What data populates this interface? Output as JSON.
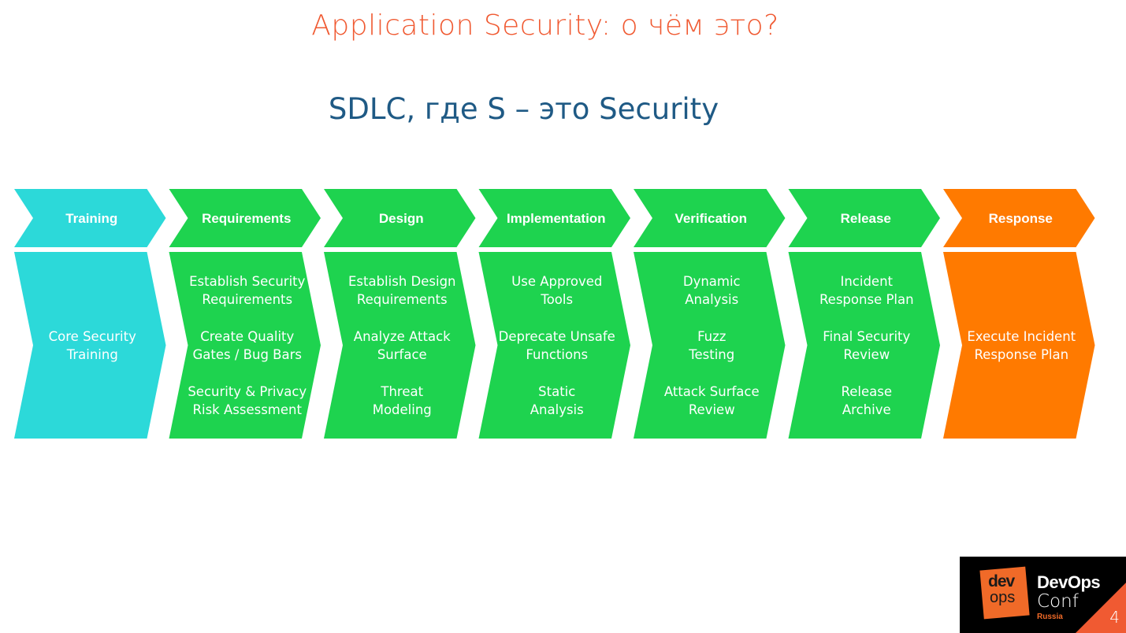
{
  "slide": {
    "title": "Application Security: о чём это?",
    "subtitle": "SDLC, где S – это Security",
    "page_number": "4"
  },
  "colors": {
    "title": "#f05a32",
    "subtitle": "#1f5a85",
    "training": "#2cd9d9",
    "phase": "#1ed34f",
    "response": "#ff7a00"
  },
  "phases": [
    {
      "name": "Training",
      "color_key": "training",
      "practices": [
        "Core Security\nTraining"
      ]
    },
    {
      "name": "Requirements",
      "color_key": "phase",
      "practices": [
        "Establish Security\nRequirements",
        "Create Quality\nGates / Bug Bars",
        "Security & Privacy\nRisk Assessment"
      ]
    },
    {
      "name": "Design",
      "color_key": "phase",
      "practices": [
        "Establish Design\nRequirements",
        "Analyze Attack\nSurface",
        "Threat\nModeling"
      ]
    },
    {
      "name": "Implementation",
      "color_key": "phase",
      "practices": [
        "Use Approved\nTools",
        "Deprecate Unsafe\nFunctions",
        "Static\nAnalysis"
      ]
    },
    {
      "name": "Verification",
      "color_key": "phase",
      "practices": [
        "Dynamic\nAnalysis",
        "Fuzz\nTesting",
        "Attack Surface\nReview"
      ]
    },
    {
      "name": "Release",
      "color_key": "phase",
      "practices": [
        "Incident\nResponse Plan",
        "Final Security\nReview",
        "Release\nArchive"
      ]
    },
    {
      "name": "Response",
      "color_key": "response",
      "practices": [
        "Execute Incident\nResponse Plan"
      ]
    }
  ],
  "logo": {
    "mark_top": "dev",
    "mark_bottom": "ops",
    "name": "DevOps",
    "suffix": "Conf",
    "region": "Russia"
  }
}
